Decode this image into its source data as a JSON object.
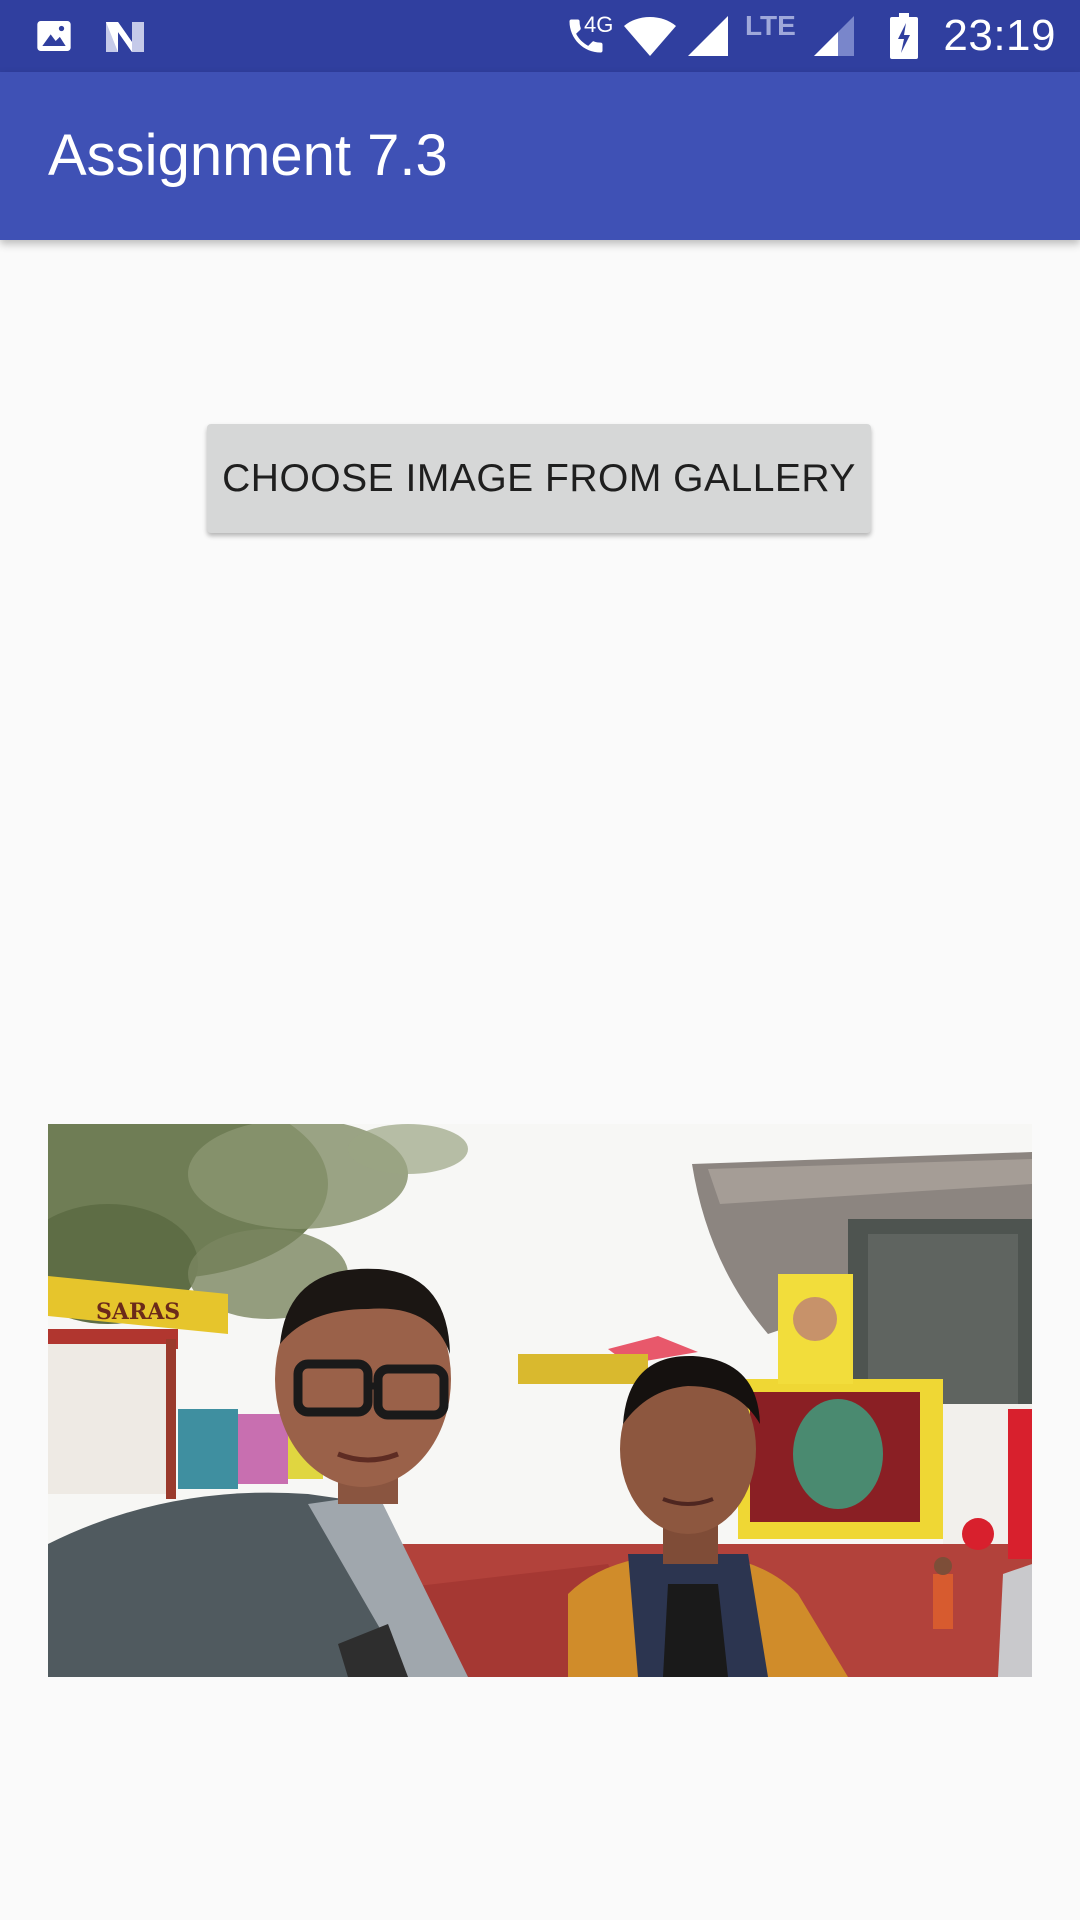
{
  "status_bar": {
    "time": "23:19",
    "network_4g": "4G",
    "network_lte": "LTE",
    "icons": [
      "gallery-notification-icon",
      "n-notification-icon",
      "wifi-calling-icon",
      "wifi-icon",
      "signal-icon",
      "lte-signal-icon",
      "battery-charging-icon"
    ]
  },
  "app_bar": {
    "title": "Assignment 7.3",
    "color": "#3f51b5",
    "status_color": "#303f9f"
  },
  "main": {
    "choose_button_label": "CHOOSE IMAGE FROM GALLERY",
    "image_alt": "Selected photo: two men taking a selfie at an outdoor fair",
    "stall_sign": "SARAS"
  }
}
